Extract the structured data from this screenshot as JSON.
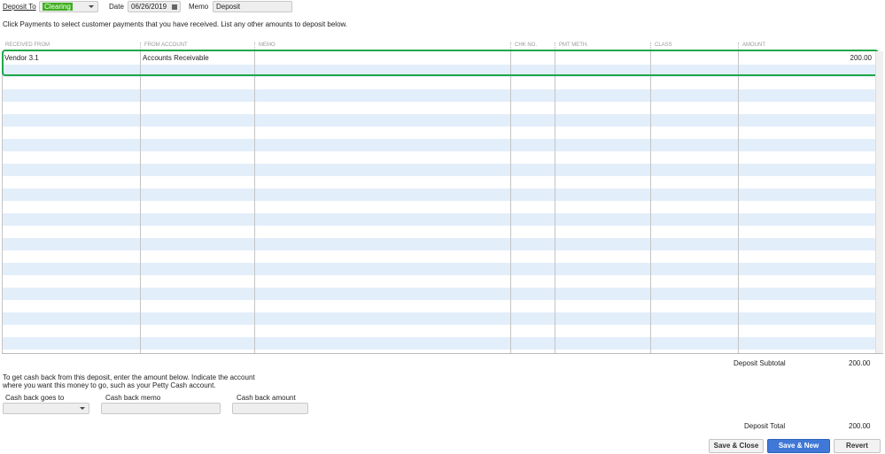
{
  "header": {
    "deposit_to_label": "Deposit To",
    "deposit_to_value": "Clearing",
    "date_label": "Date",
    "date_value": "06/26/2019",
    "memo_label": "Memo",
    "memo_value": "Deposit"
  },
  "instructions": "Click Payments to select customer payments that you have received. List any other amounts to deposit below.",
  "table": {
    "columns": [
      "RECEIVED FROM",
      "FROM ACCOUNT",
      "MEMO",
      "CHK NO.",
      "PMT METH.",
      "CLASS",
      "AMOUNT"
    ],
    "rows": [
      {
        "received_from": "Vendor 3.1",
        "from_account": "Accounts Receivable",
        "memo": "",
        "chk_no": "",
        "pmt_meth": "",
        "class": "",
        "amount": "200.00"
      }
    ]
  },
  "subtotal": {
    "label": "Deposit Subtotal",
    "value": "200.00"
  },
  "cashback": {
    "instructions_1": "To get cash back from this deposit, enter the amount below.  Indicate the account",
    "instructions_2": "where you want this money to go, such as your Petty Cash account.",
    "goes_to_label": "Cash back goes to",
    "memo_label": "Cash back memo",
    "amount_label": "Cash back amount"
  },
  "total": {
    "label": "Deposit Total",
    "value": "200.00"
  },
  "buttons": {
    "save_close": "Save & Close",
    "save_new": "Save & New",
    "revert": "Revert"
  }
}
